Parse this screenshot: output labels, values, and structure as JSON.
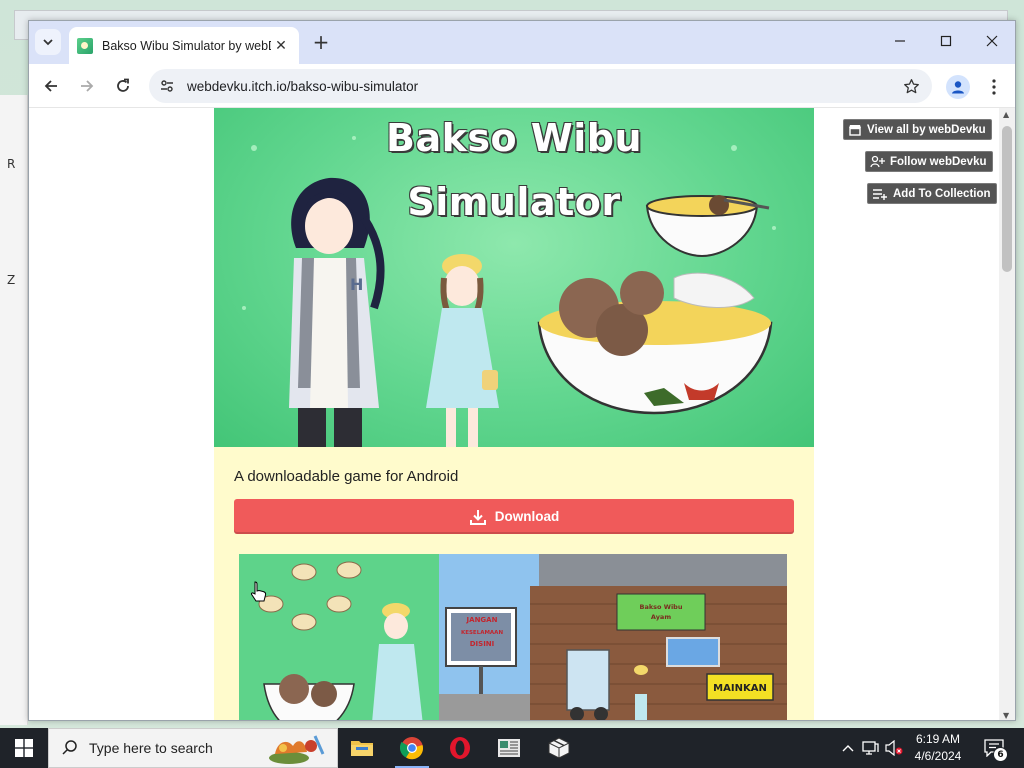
{
  "desktop": {
    "edge_glyphs": [
      "R",
      "Z"
    ]
  },
  "browser": {
    "tab": {
      "title": "Bakso Wibu Simulator by webDevku",
      "favicon": "itch-game-favicon"
    },
    "new_tab_icon": "plus-icon",
    "window_controls": [
      "minimize-icon",
      "maximize-icon",
      "close-icon"
    ],
    "toolbar": {
      "back_icon": "arrow-left-icon",
      "forward_icon": "arrow-right-icon",
      "reload_icon": "reload-icon",
      "site_info_icon": "tune-icon",
      "url": "webdevku.itch.io/bakso-wibu-simulator",
      "bookmark_icon": "star-icon",
      "profile_icon": "person-icon",
      "menu_icon": "kebab-icon"
    }
  },
  "page": {
    "banner": {
      "title_line1": "Bakso Wibu",
      "title_line2": "Simulator",
      "colors": {
        "bg": "#5fd68d",
        "title": "#ffffff"
      }
    },
    "tagline": "A downloadable game for Android",
    "download_button": {
      "label": "Download",
      "icon": "download-icon",
      "color": "#f05a5a"
    },
    "screenshot": {
      "sign_text": "JANGAN KESELAMAAN DISINI",
      "shop_sign": "Bakso Wibu Ayam",
      "play_button": "MAINKAN"
    },
    "side_buttons": [
      {
        "label": "View all by webDevku",
        "icon": "itch-store-icon"
      },
      {
        "label": "Follow webDevku",
        "icon": "person-add-icon"
      },
      {
        "label": "Add To Collection",
        "icon": "playlist-add-icon"
      }
    ]
  },
  "taskbar": {
    "search_placeholder": "Type here to search",
    "apps": [
      "file-explorer-icon",
      "chrome-icon",
      "opera-icon",
      "news-app-icon",
      "package-icon"
    ],
    "clock_time": "6:19 AM",
    "clock_date": "4/6/2024",
    "notification_count": "6"
  }
}
